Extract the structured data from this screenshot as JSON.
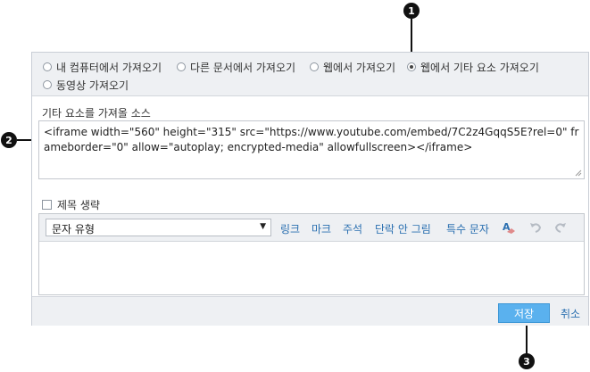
{
  "callouts": {
    "c1": "1",
    "c2": "2",
    "c3": "3"
  },
  "import_options": [
    {
      "label": "내 컴퓨터에서 가져오기",
      "checked": false
    },
    {
      "label": "다른 문서에서 가져오기",
      "checked": false
    },
    {
      "label": "웹에서 가져오기",
      "checked": false
    },
    {
      "label": "웹에서 기타 요소 가져오기",
      "checked": true
    },
    {
      "label": "동영상 가져오기",
      "checked": false
    }
  ],
  "source": {
    "label": "기타 요소를 가져올 소스",
    "value": "<iframe width=\"560\" height=\"315\" src=\"https://www.youtube.com/embed/7C2z4GqqS5E?rel=0\" frameborder=\"0\" allow=\"autoplay; encrypted-media\" allowfullscreen></iframe>"
  },
  "omit_title": {
    "label": "제목 생략",
    "checked": false
  },
  "toolbar": {
    "text_type_select": "문자 유형",
    "link": "링크",
    "mark": "마크",
    "comment": "주석",
    "no_break": "단락 안 그림",
    "special_chars": "특수 문자",
    "format_icon": "text-format-icon",
    "undo_icon": "undo-icon",
    "redo_icon": "redo-icon"
  },
  "footer": {
    "save": "저장",
    "cancel": "취소"
  },
  "colors": {
    "accent": "#5ab1ee",
    "link": "#2a6fb0",
    "panel": "#eef0f3"
  }
}
